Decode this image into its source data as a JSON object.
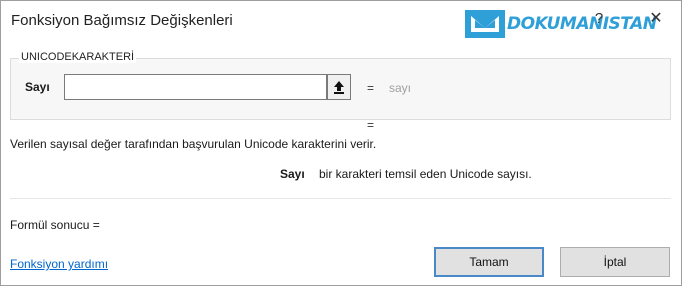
{
  "dialog": {
    "title": "Fonksiyon Bağımsız Değişkenleri",
    "help_glyph": "?",
    "close_glyph": "✕",
    "watermark_text": "DOKUMANISTAN",
    "watermark_color": "#2f9fd8"
  },
  "function_group": {
    "name": "UNICODEKARAKTERİ",
    "argument": {
      "label": "Sayı",
      "value": "",
      "collapse_icon": "collapse-dialog-icon",
      "result_equals": "=",
      "result_value": "sayı"
    },
    "function_result_equals": "="
  },
  "description": "Verilen sayısal değer tarafından başvurulan Unicode karakterini verir.",
  "argument_description": {
    "name": "Sayı",
    "text": "bir karakteri temsil eden Unicode sayısı."
  },
  "formula_result": "Formül sonucu =",
  "footer": {
    "help_link": "Fonksiyon yardımı",
    "ok_label": "Tamam",
    "cancel_label": "İptal"
  },
  "colors": {
    "accent_border": "#4a89c8",
    "link": "#0066cc"
  }
}
